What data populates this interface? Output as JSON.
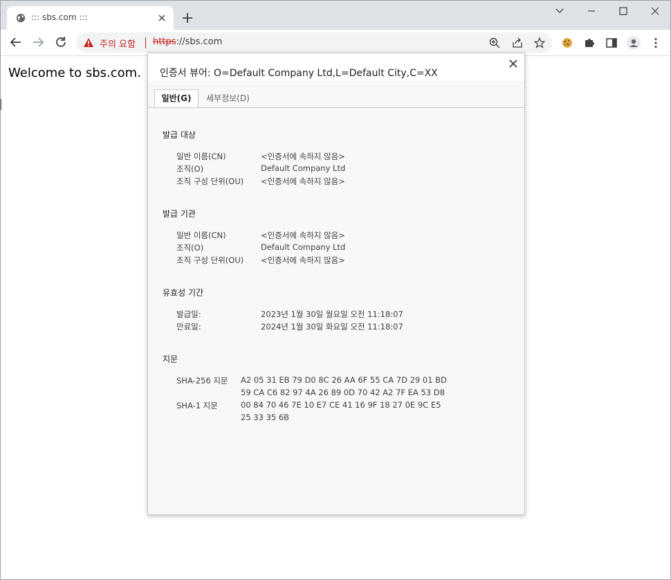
{
  "browser": {
    "tab": {
      "title": "::: sbs.com :::"
    },
    "omnibox": {
      "warning_label": "주의 요함",
      "url_scheme": "https",
      "url_rest": "://sbs.com"
    }
  },
  "page": {
    "welcome_text": "Welcome to sbs.com."
  },
  "dialog": {
    "title": "인증서 뷰어: O=Default Company Ltd,L=Default City,C=XX",
    "tabs": [
      {
        "label": "일반(G)",
        "active": true
      },
      {
        "label": "세부정보(D)",
        "active": false
      }
    ],
    "issued_to": {
      "heading": "발급 대상",
      "rows": [
        {
          "label": "일반 이름(CN)",
          "value": "<인증서에 속하지 않음>"
        },
        {
          "label": "조직(O)",
          "value": "Default Company Ltd"
        },
        {
          "label": "조직 구성 단위(OU)",
          "value": "<인증서에 속하지 않음>"
        }
      ]
    },
    "issued_by": {
      "heading": "발급 기관",
      "rows": [
        {
          "label": "일반 이름(CN)",
          "value": "<인증서에 속하지 않음>"
        },
        {
          "label": "조직(O)",
          "value": "Default Company Ltd"
        },
        {
          "label": "조직 구성 단위(OU)",
          "value": "<인증서에 속하지 않음>"
        }
      ]
    },
    "validity": {
      "heading": "유효성 기간",
      "rows": [
        {
          "label": "발급일:",
          "value": "2023년 1월 30일 월요일 오전 11:18:07"
        },
        {
          "label": "만료일:",
          "value": "2024년 1월 30일 화요일 오전 11:18:07"
        }
      ]
    },
    "fingerprints": {
      "heading": "지문",
      "sha256": {
        "label": "SHA-256 지문",
        "line1": "A2 05 31 EB 79 D0 8C 26 AA 6F 55 CA 7D 29 01 BD",
        "line2": "59 CA C6 82 97 4A 26 89 0D 70 42 A2 7F EA 53 D8"
      },
      "sha1": {
        "label": "SHA-1 지문",
        "line1": "00 84 70 46 7E 10 E7 CE 41 16 9F 18 27 0E 9C E5",
        "line2": "25 33 35 6B"
      }
    }
  },
  "colors": {
    "tabstrip_bg": "#dee1e6",
    "warning_red": "#c5221f",
    "dialog_bg": "#f8f8f8"
  }
}
